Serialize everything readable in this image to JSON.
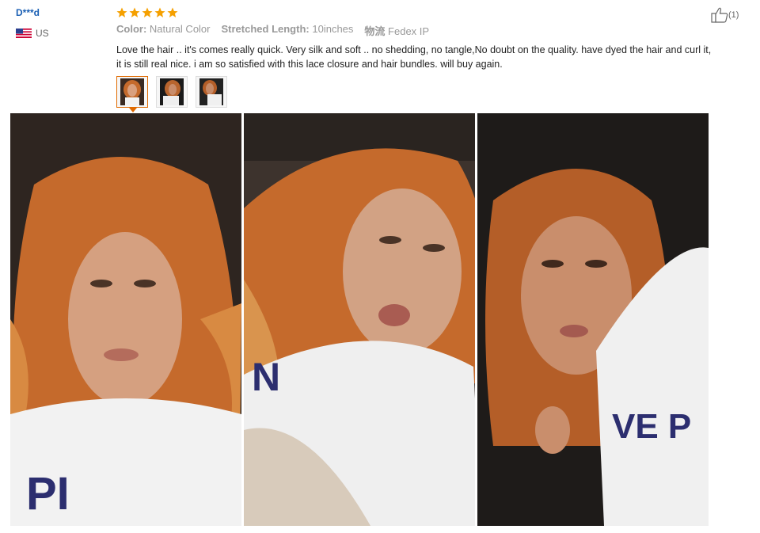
{
  "reviewer": {
    "name": "D***d",
    "country": "US",
    "flag_icon": "us-flag-icon"
  },
  "rating": {
    "stars": 5,
    "star_color": "#f5a000",
    "star_icon": "star-icon"
  },
  "attributes": [
    {
      "label": "Color:",
      "value": "Natural Color"
    },
    {
      "label": "Stretched Length:",
      "value": "10inches"
    },
    {
      "label": "物流",
      "value": "Fedex IP"
    }
  ],
  "review_text": "Love the hair .. it's comes really quick. Very silk and soft .. no shedding, no tangle,No doubt on the quality. have dyed the hair and curl it, it is still real nice. i am so satisfied with this lace closure and hair bundles. will buy again.",
  "thumbnails": [
    {
      "name": "thumbnail-1",
      "active": true
    },
    {
      "name": "thumbnail-2",
      "active": false
    },
    {
      "name": "thumbnail-3",
      "active": false
    }
  ],
  "helpful": {
    "count_label": "(1)",
    "icon": "thumbs-up-icon"
  },
  "colors": {
    "link": "#1a5fb4",
    "active_border": "#e06a00",
    "hair": "#c56a2c"
  }
}
